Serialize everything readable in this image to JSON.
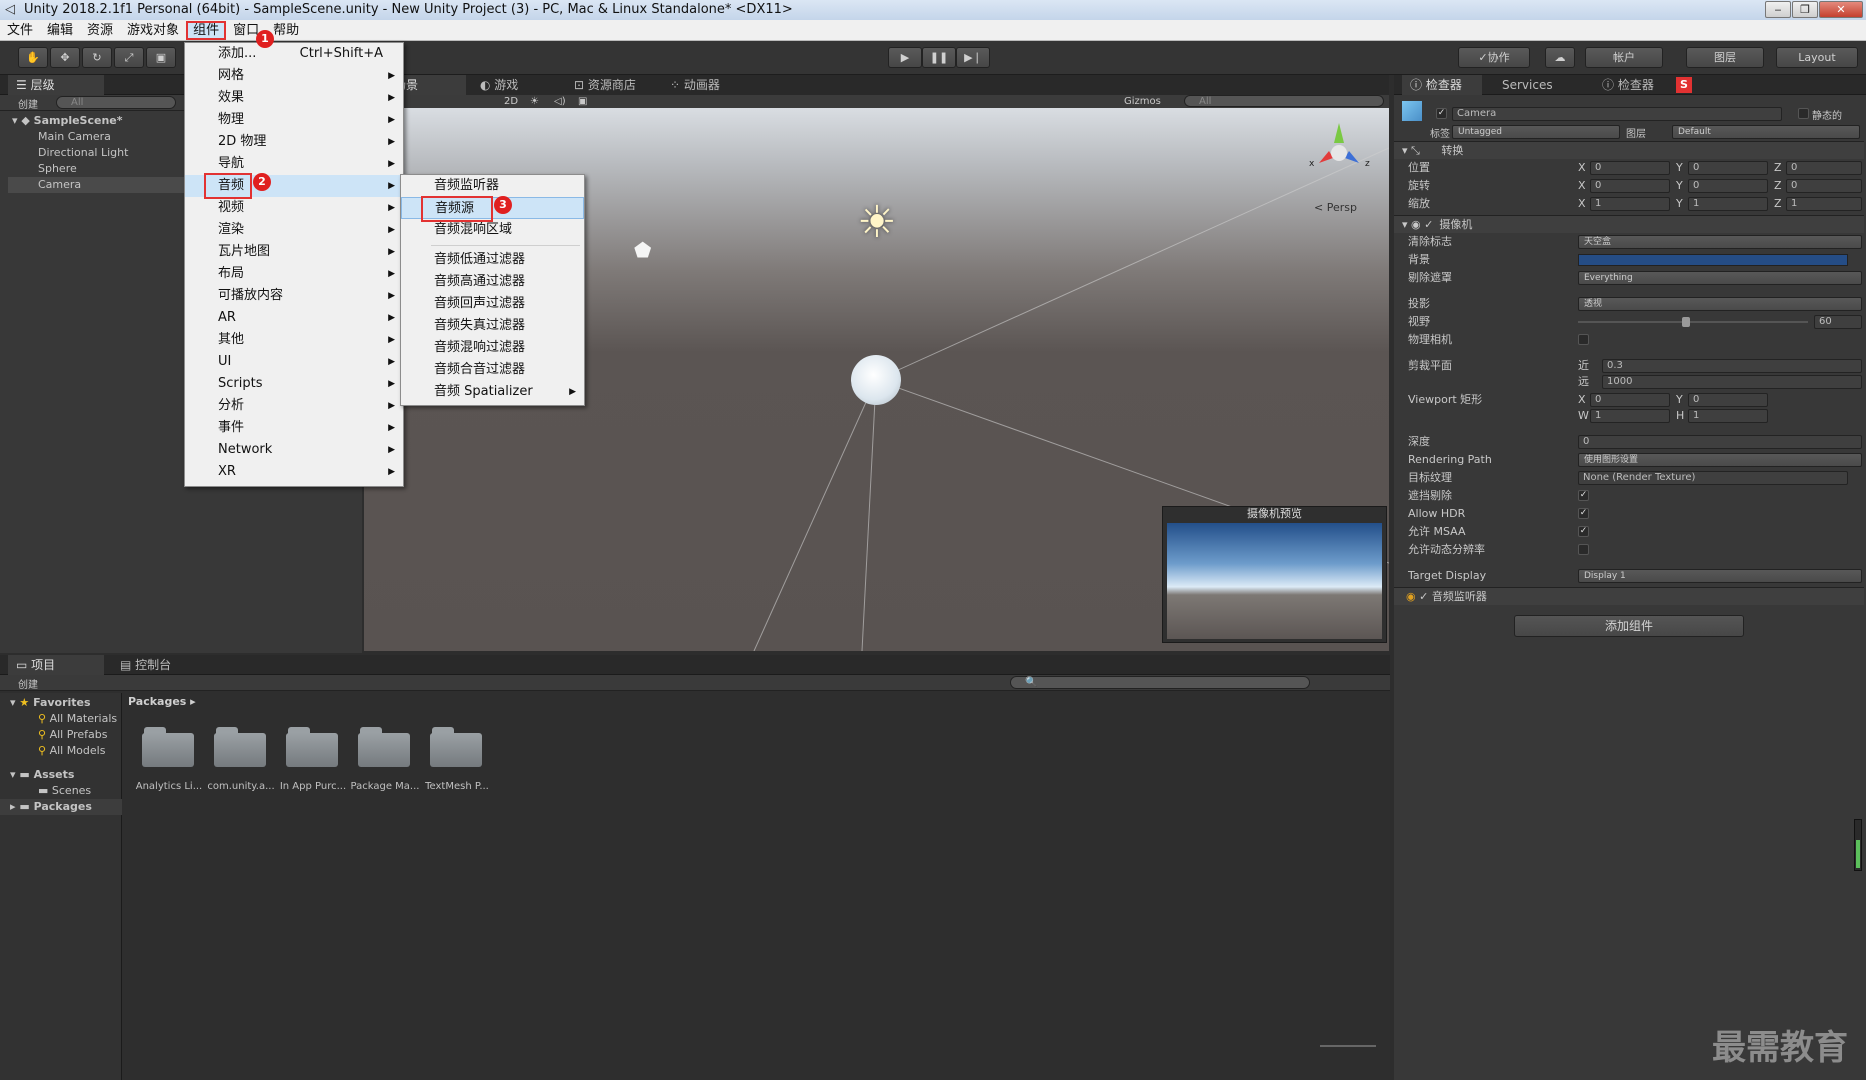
{
  "window": {
    "title": "Unity 2018.2.1f1 Personal (64bit) - SampleScene.unity - New Unity Project (3) - PC, Mac & Linux Standalone* <DX11>",
    "min": "‒",
    "max": "❐",
    "close": "✕"
  },
  "menubar": [
    "文件",
    "编辑",
    "资源",
    "游戏对象",
    "组件",
    "窗口",
    "帮助"
  ],
  "toolbar": {
    "collab": "✓协作",
    "account": "帐户",
    "layers": "图层",
    "layout": "Layout"
  },
  "hierarchy": {
    "tab": "层级",
    "create": "创建",
    "search": "All",
    "scene": "SampleScene*",
    "items": [
      "Main Camera",
      "Directional Light",
      "Sphere",
      "Camera"
    ]
  },
  "scene_tabs": [
    "场景",
    "游戏",
    "资源商店",
    "动画器"
  ],
  "scene_bar": {
    "mode2d": "2D",
    "gizmos": "Gizmos",
    "search": "All"
  },
  "scene_view": {
    "persp": "Persp",
    "preview_title": "摄像机预览"
  },
  "component_menu": {
    "items": [
      {
        "label": "添加...",
        "shortcut": "Ctrl+Shift+A"
      },
      {
        "label": "网格"
      },
      {
        "label": "效果"
      },
      {
        "label": "物理"
      },
      {
        "label": "2D 物理"
      },
      {
        "label": "导航"
      },
      {
        "label": "音频"
      },
      {
        "label": "视频"
      },
      {
        "label": "渲染"
      },
      {
        "label": "瓦片地图"
      },
      {
        "label": "布局"
      },
      {
        "label": "可播放内容"
      },
      {
        "label": "AR"
      },
      {
        "label": "其他"
      },
      {
        "label": "UI"
      },
      {
        "label": "Scripts"
      },
      {
        "label": "分析"
      },
      {
        "label": "事件"
      },
      {
        "label": "Network"
      },
      {
        "label": "XR"
      }
    ]
  },
  "audio_menu": {
    "items": [
      "音频监听器",
      "音频源",
      "音频混响区域",
      "音频低通过滤器",
      "音频高通过滤器",
      "音频回声过滤器",
      "音频失真过滤器",
      "音频混响过滤器",
      "音频合音过滤器",
      "音频 Spatializer"
    ]
  },
  "badges": [
    "1",
    "2",
    "3"
  ],
  "inspector": {
    "tabs": [
      "检查器",
      "Services",
      "检查器"
    ],
    "object_name": "Camera",
    "static": "静态的",
    "tag_label": "标签",
    "tag": "Untagged",
    "layer_label": "图层",
    "layer": "Default",
    "transform": {
      "title": "转换",
      "position": "位置",
      "rotation": "旋转",
      "scale": "缩放",
      "x": "X",
      "y": "Y",
      "z": "Z",
      "pos": [
        "0",
        "0",
        "0"
      ],
      "rot": [
        "0",
        "0",
        "0"
      ],
      "scl": [
        "1",
        "1",
        "1"
      ]
    },
    "camera": {
      "title": "摄像机",
      "clear_flags": "清除标志",
      "clear_value": "天空盒",
      "background": "背景",
      "culling_mask": "剔除遮罩",
      "culling_value": "Everything",
      "projection": "投影",
      "projection_value": "透视",
      "fov": "视野",
      "fov_value": "60",
      "physical": "物理相机",
      "clipping": "剪裁平面",
      "near": "近",
      "near_value": "0.3",
      "far": "远",
      "far_value": "1000",
      "viewport": "Viewport 矩形",
      "vx": "X",
      "vx_value": "0",
      "vy": "Y",
      "vy_value": "0",
      "vw": "W",
      "vw_value": "1",
      "vh": "H",
      "vh_value": "1",
      "depth": "深度",
      "depth_value": "0",
      "rendering_path": "Rendering Path",
      "rendering_value": "使用图形设置",
      "target_texture": "目标纹理",
      "target_value": "None (Render Texture)",
      "occlusion": "遮挡剔除",
      "hdr": "Allow HDR",
      "msaa": "允许 MSAA",
      "dynamic_res": "允许动态分辨率",
      "target_display": "Target Display",
      "target_display_value": "Display 1"
    },
    "audio_listener": "音频监听器",
    "add_component": "添加组件"
  },
  "project": {
    "tabs": [
      "项目",
      "控制台"
    ],
    "create": "创建",
    "favorites": "Favorites",
    "fav_items": [
      "All Materials",
      "All Prefabs",
      "All Models"
    ],
    "assets": "Assets",
    "scenes": "Scenes",
    "packages": "Packages",
    "breadcrumb": "Packages",
    "folders": [
      "Analytics Li...",
      "com.unity.a...",
      "In App Purc...",
      "Package Ma...",
      "TextMesh P..."
    ]
  },
  "watermark": "最需教育"
}
